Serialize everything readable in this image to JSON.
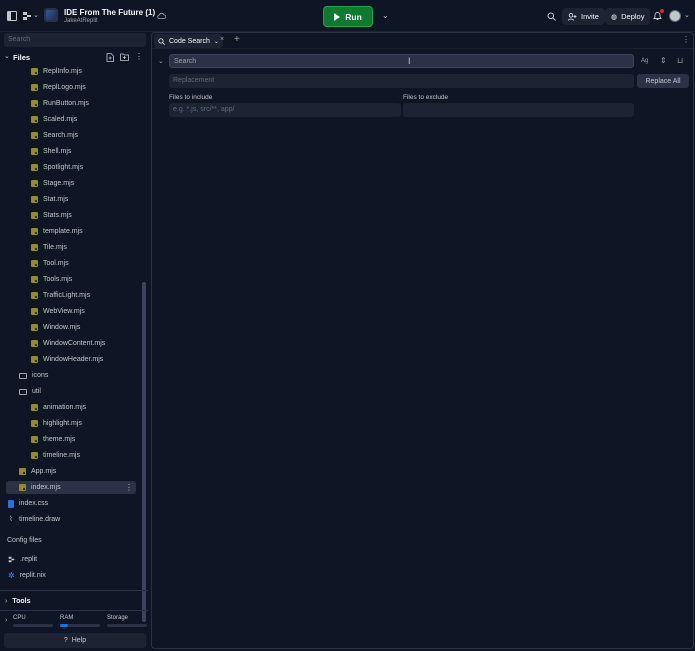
{
  "topbar": {
    "repl_title": "IDE From The Future (1)",
    "repl_owner": "JakeAtReplit",
    "run_label": "Run",
    "invite_label": "Invite",
    "deploy_label": "Deploy",
    "icons": [
      "sidebar-toggle-icon",
      "replit-logo-icon",
      "chevron-down-icon",
      "cloud-icon",
      "search-icon",
      "invite-icon",
      "deploy-icon",
      "bell-icon",
      "user-avatar"
    ]
  },
  "sidebar": {
    "search_placeholder": "Search",
    "files_title": "Files",
    "tree": [
      {
        "name": "ReplInfo.mjs",
        "type": "js",
        "indent": 2
      },
      {
        "name": "ReplLogo.mjs",
        "type": "js",
        "indent": 2
      },
      {
        "name": "RunButton.mjs",
        "type": "js",
        "indent": 2
      },
      {
        "name": "Scaled.mjs",
        "type": "js",
        "indent": 2
      },
      {
        "name": "Search.mjs",
        "type": "js",
        "indent": 2
      },
      {
        "name": "Shell.mjs",
        "type": "js",
        "indent": 2
      },
      {
        "name": "Spotlight.mjs",
        "type": "js",
        "indent": 2
      },
      {
        "name": "Stage.mjs",
        "type": "js",
        "indent": 2
      },
      {
        "name": "Stat.mjs",
        "type": "js",
        "indent": 2
      },
      {
        "name": "Stats.mjs",
        "type": "js",
        "indent": 2
      },
      {
        "name": "template.mjs",
        "type": "js",
        "indent": 2
      },
      {
        "name": "Tile.mjs",
        "type": "js",
        "indent": 2
      },
      {
        "name": "Tool.mjs",
        "type": "js",
        "indent": 2
      },
      {
        "name": "Tools.mjs",
        "type": "js",
        "indent": 2
      },
      {
        "name": "TrafficLight.mjs",
        "type": "js",
        "indent": 2
      },
      {
        "name": "WebView.mjs",
        "type": "js",
        "indent": 2
      },
      {
        "name": "Window.mjs",
        "type": "js",
        "indent": 2
      },
      {
        "name": "WindowContent.mjs",
        "type": "js",
        "indent": 2
      },
      {
        "name": "WindowHeader.mjs",
        "type": "js",
        "indent": 2
      },
      {
        "name": "icons",
        "type": "folder",
        "indent": 1
      },
      {
        "name": "util",
        "type": "folder-open",
        "indent": 1
      },
      {
        "name": "animation.mjs",
        "type": "js",
        "indent": 2
      },
      {
        "name": "highlight.mjs",
        "type": "js",
        "indent": 2
      },
      {
        "name": "theme.mjs",
        "type": "js",
        "indent": 2
      },
      {
        "name": "timeline.mjs",
        "type": "js",
        "indent": 2
      },
      {
        "name": "App.mjs",
        "type": "js",
        "indent": 1
      },
      {
        "name": "index.mjs",
        "type": "js",
        "indent": 1,
        "selected": true
      },
      {
        "name": "index.css",
        "type": "css",
        "indent": 0
      },
      {
        "name": "timeline.draw",
        "type": "draw",
        "indent": 0
      }
    ],
    "config_title": "Config files",
    "config_files": [
      {
        "name": ".replit",
        "type": "replit"
      },
      {
        "name": "replit.nix",
        "type": "gear"
      }
    ],
    "tools_title": "Tools",
    "meters": {
      "cpu_label": "CPU",
      "ram_label": "RAM",
      "storage_label": "Storage",
      "cpu_fraction": 0.0,
      "ram_fraction": 0.2,
      "storage_fraction": 0.0
    },
    "help_label": "Help",
    "colors": {
      "accent": "#0079f2",
      "js_icon": "#9a8a18",
      "css_icon": "#2a6fdb"
    }
  },
  "main": {
    "tab_label": "Code Search",
    "search_placeholder": "Search",
    "replacement_placeholder": "Replacement",
    "replace_all_label": "Replace All",
    "include_label": "Files to include",
    "include_placeholder": "e.g. *.js, src/**, app/",
    "exclude_label": "Files to exclude"
  }
}
